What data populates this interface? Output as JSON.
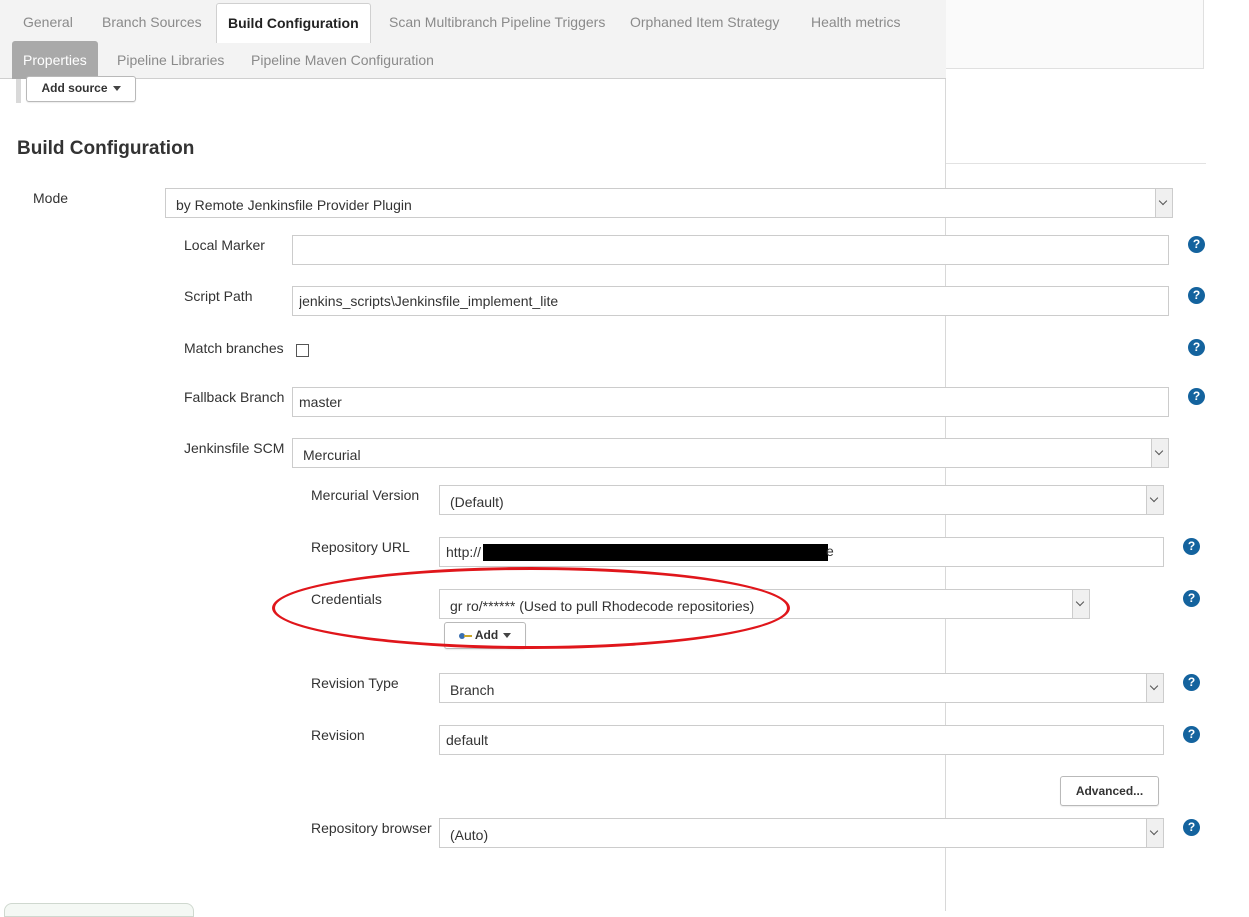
{
  "tabs": {
    "general": "General",
    "branch_sources": "Branch Sources",
    "build_configuration": "Build Configuration",
    "scan_triggers": "Scan Multibranch Pipeline Triggers",
    "orphaned": "Orphaned Item Strategy",
    "health": "Health metrics",
    "properties": "Properties",
    "libraries": "Pipeline Libraries",
    "maven": "Pipeline Maven Configuration"
  },
  "add_source_label": "Add source",
  "section_title": "Build Configuration",
  "mode": {
    "label": "Mode",
    "value": "by Remote Jenkinsfile Provider Plugin"
  },
  "local_marker": {
    "label": "Local Marker",
    "value": ""
  },
  "script_path": {
    "label": "Script Path",
    "value": "jenkins_scripts\\Jenkinsfile_implement_lite"
  },
  "match_branches": {
    "label": "Match branches",
    "checked": false
  },
  "fallback_branch": {
    "label": "Fallback Branch",
    "value": "master"
  },
  "jenkinsfile_scm": {
    "label": "Jenkinsfile SCM",
    "value": "Mercurial"
  },
  "mercurial_version": {
    "label": "Mercurial Version",
    "value": "(Default)"
  },
  "repository_url": {
    "label": "Repository URL",
    "prefix": "http://",
    "suffix": "e"
  },
  "credentials": {
    "label": "Credentials",
    "value": "gr  ro/****** (Used to pull Rhodecode repositories)",
    "add_label": "Add"
  },
  "revision_type": {
    "label": "Revision Type",
    "value": "Branch"
  },
  "revision": {
    "label": "Revision",
    "value": "default"
  },
  "advanced_label": "Advanced...",
  "repository_browser": {
    "label": "Repository browser",
    "value": "(Auto)"
  },
  "help_glyph": "?",
  "colors": {
    "help_icon": "#14639e",
    "annotation_ellipse": "#e0161b",
    "active_tab": "#a9a9a9"
  }
}
